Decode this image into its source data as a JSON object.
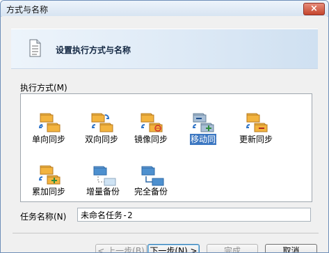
{
  "window": {
    "title": "方式与名称",
    "close_label": "×"
  },
  "header": {
    "title": "设置执行方式与名称"
  },
  "modes": {
    "label": "执行方式(M)",
    "items": [
      {
        "label": "单向同步",
        "icon": "one-way-sync-icon"
      },
      {
        "label": "双向同步",
        "icon": "two-way-sync-icon"
      },
      {
        "label": "镜像同步",
        "icon": "mirror-sync-icon"
      },
      {
        "label": "移动同步",
        "icon": "move-sync-icon",
        "selected": true
      },
      {
        "label": "更新同步",
        "icon": "update-sync-icon"
      },
      {
        "label": "累加同步",
        "icon": "cumulative-sync-icon"
      },
      {
        "label": "增量备份",
        "icon": "incremental-backup-icon"
      },
      {
        "label": "完全备份",
        "icon": "full-backup-icon"
      }
    ]
  },
  "task": {
    "label": "任务名称(N)",
    "value": "未命名任务-2"
  },
  "buttons": {
    "prev": "< 上一步(B)",
    "next": "下一步(N) >",
    "finish": "完成",
    "cancel": "取消"
  }
}
